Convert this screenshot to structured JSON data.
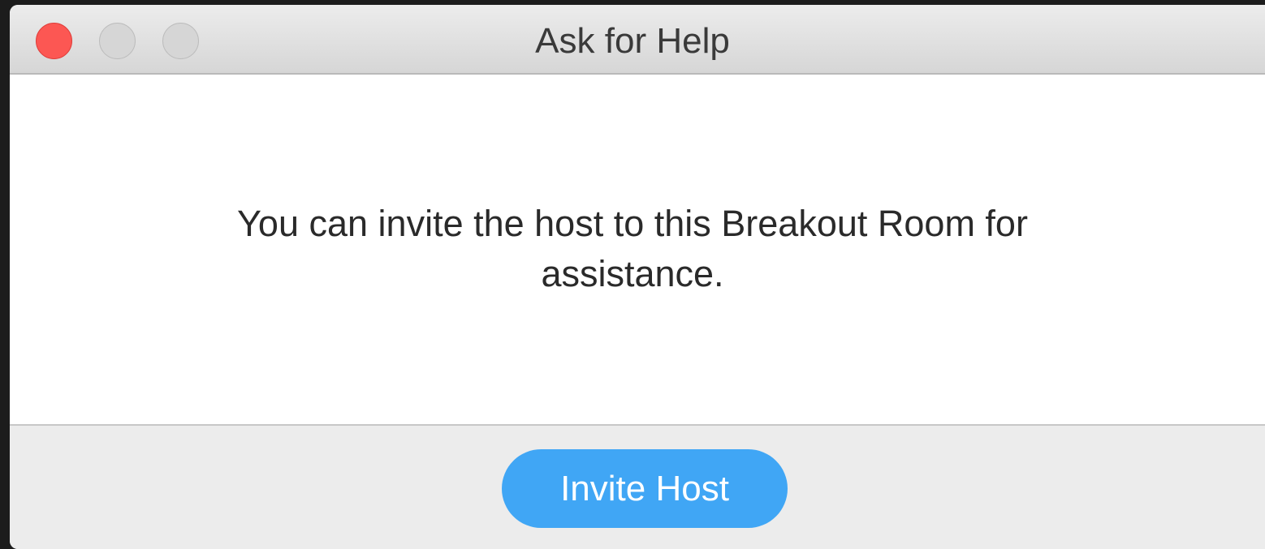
{
  "window": {
    "title": "Ask for Help",
    "controls": [
      "close",
      "minimize",
      "zoom"
    ]
  },
  "dialog": {
    "message": "You can invite the host to this Breakout Room for assistance."
  },
  "footer": {
    "invite_button_label": "Invite Host"
  },
  "colors": {
    "close": "#fc5753",
    "inactive_control": "#d6d6d6",
    "accent": "#40a6f5"
  }
}
